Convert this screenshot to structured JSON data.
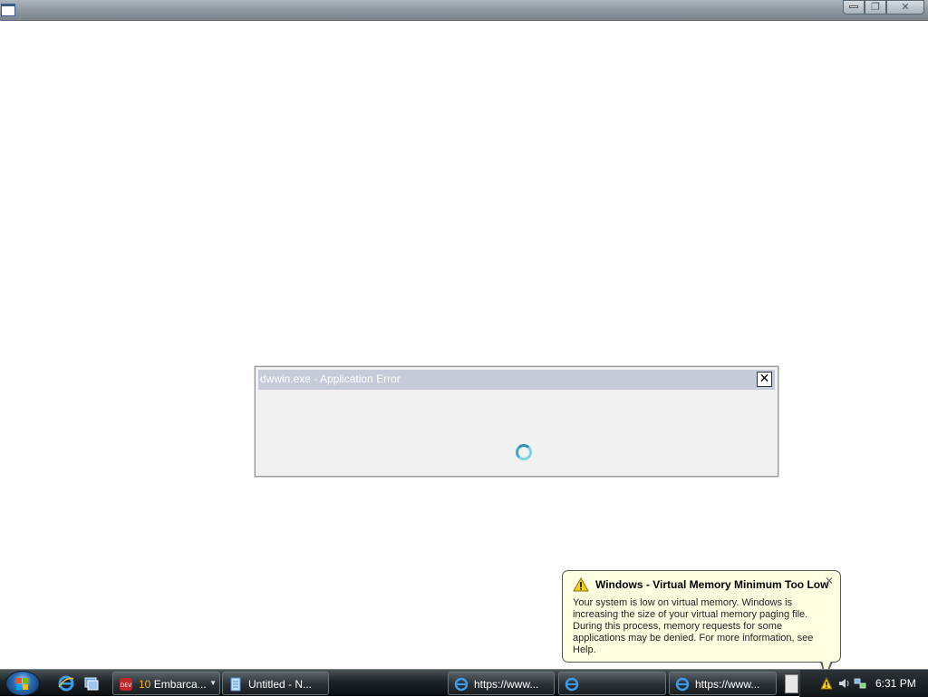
{
  "window": {
    "title": "",
    "controls": {
      "minimize": "—",
      "maximize": "❐",
      "close": "✕"
    }
  },
  "dialog": {
    "title": "dwwin.exe - Application Error",
    "close_label": "✕"
  },
  "balloon": {
    "title": "Windows - Virtual Memory Minimum Too Low",
    "close_label": "✕",
    "body": "Your system is low on virtual memory. Windows is increasing the size of your virtual memory paging file. During this process, memory requests for some applications may be denied. For more information, see Help.",
    "icon": "warning-icon"
  },
  "taskbar": {
    "start_icon": "windows-logo-icon",
    "quick_launch": [
      {
        "name": "internet-explorer-icon"
      },
      {
        "name": "switch-windows-icon"
      }
    ],
    "buttons": [
      {
        "count": "10",
        "label": "Embarca...",
        "icon": "devcon-icon"
      },
      {
        "label": "Untitled - N...",
        "icon": "notepad-icon"
      },
      {
        "label": "https://www...",
        "icon": "ie-icon"
      },
      {
        "label": "",
        "icon": "ie-icon"
      },
      {
        "label": "https://www...",
        "icon": "ie-icon"
      }
    ],
    "clock": "6:31 PM"
  },
  "colors": {
    "taskbar": "#1d2326",
    "balloon_bg": "#ffffe1",
    "dialog_title": "#c5cbd9"
  }
}
